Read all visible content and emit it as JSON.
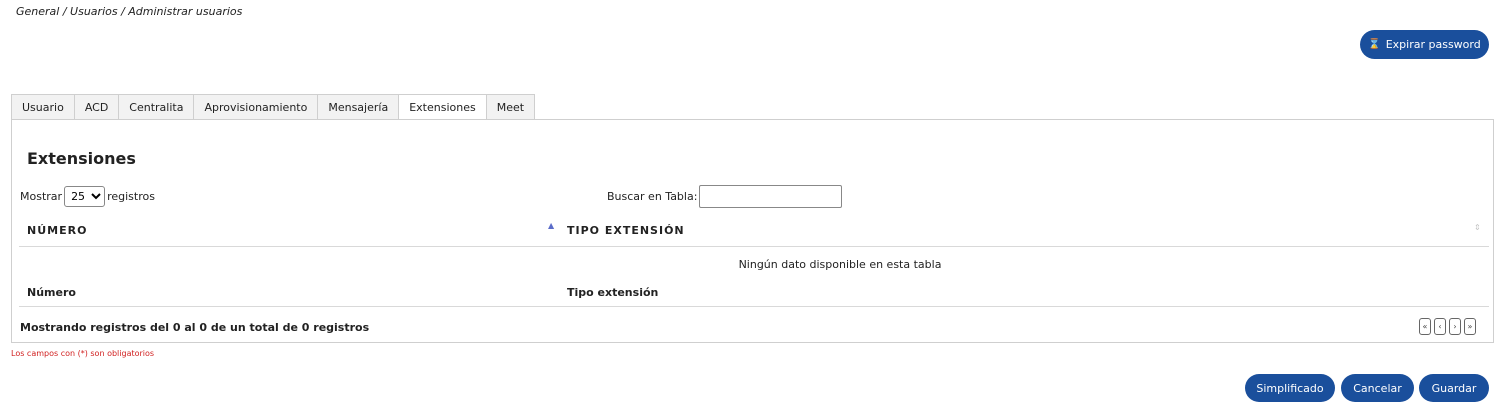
{
  "breadcrumb": "General / Usuarios / Administrar usuarios",
  "expirar_button": {
    "icon": "hourglass-icon",
    "glyph": "⌛",
    "label": "Expirar password"
  },
  "tabs": [
    {
      "label": "Usuario",
      "active": false
    },
    {
      "label": "ACD",
      "active": false
    },
    {
      "label": "Centralita",
      "active": false
    },
    {
      "label": "Aprovisionamiento",
      "active": false
    },
    {
      "label": "Mensajería",
      "active": false
    },
    {
      "label": "Extensiones",
      "active": true
    },
    {
      "label": "Meet",
      "active": false
    }
  ],
  "section_title": "Extensiones",
  "length": {
    "prefix": "Mostrar",
    "selected": "25",
    "suffix": "registros"
  },
  "search": {
    "label": "Buscar en Tabla:",
    "value": ""
  },
  "table": {
    "headers": [
      "NÚMERO",
      "TIPO EXTENSIÓN"
    ],
    "empty_message": "Ningún dato disponible en esta tabla",
    "footers": [
      "Número",
      "Tipo extensión"
    ],
    "sort_glyph_asc": "▲",
    "sort_glyph_both": "⇕"
  },
  "info": "Mostrando registros del 0 al 0 de un total de 0 registros",
  "pagination": [
    "«",
    "‹",
    "›",
    "»"
  ],
  "required_note": "Los campos con (*) son obligatorios",
  "actions": {
    "simplificado": "Simplificado",
    "cancelar": "Cancelar",
    "guardar": "Guardar"
  },
  "colors": {
    "primary": "#1a4f9c",
    "required": "#d11f1f",
    "sort_active": "#5b6cc9"
  }
}
